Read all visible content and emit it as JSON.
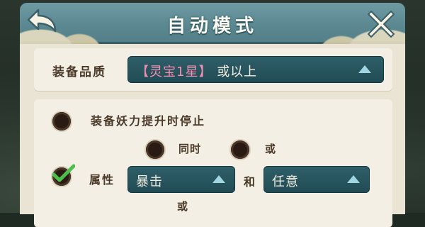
{
  "window": {
    "title": "自动模式"
  },
  "quality": {
    "label": "装备品质",
    "selected_prefix": "【灵宝1星】",
    "selected_suffix": "或以上"
  },
  "stop_rule": {
    "label": "装备妖力提升时停止",
    "option_simultaneous": "同时",
    "option_or": "或",
    "attribute_label": "属性",
    "attribute_value_1": "暴击",
    "connector": "和",
    "attribute_value_2": "任意",
    "trailing_or": "或",
    "attribute_checked": true
  },
  "colors": {
    "accent_pink": "#f28fb2",
    "check_green": "#4cc04a",
    "dropdown_bg": "#214b54",
    "header_bg": "#5b8891"
  }
}
